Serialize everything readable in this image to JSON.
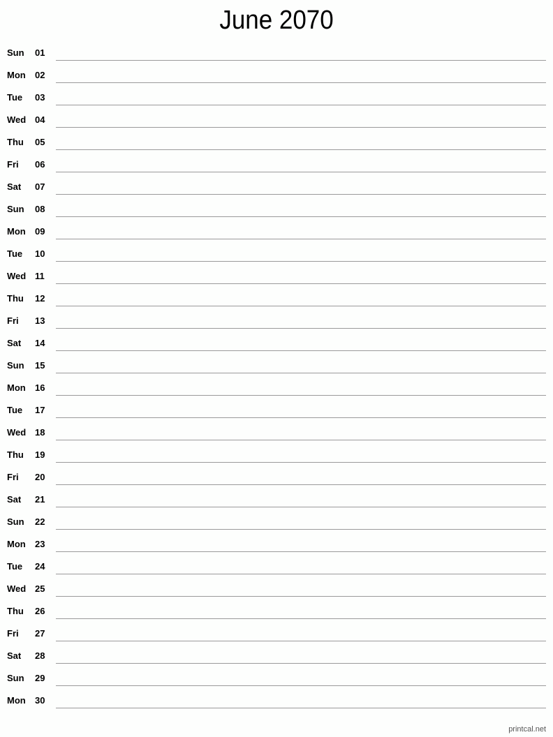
{
  "title": "June 2070",
  "days": [
    {
      "dow": "Sun",
      "day": "01"
    },
    {
      "dow": "Mon",
      "day": "02"
    },
    {
      "dow": "Tue",
      "day": "03"
    },
    {
      "dow": "Wed",
      "day": "04"
    },
    {
      "dow": "Thu",
      "day": "05"
    },
    {
      "dow": "Fri",
      "day": "06"
    },
    {
      "dow": "Sat",
      "day": "07"
    },
    {
      "dow": "Sun",
      "day": "08"
    },
    {
      "dow": "Mon",
      "day": "09"
    },
    {
      "dow": "Tue",
      "day": "10"
    },
    {
      "dow": "Wed",
      "day": "11"
    },
    {
      "dow": "Thu",
      "day": "12"
    },
    {
      "dow": "Fri",
      "day": "13"
    },
    {
      "dow": "Sat",
      "day": "14"
    },
    {
      "dow": "Sun",
      "day": "15"
    },
    {
      "dow": "Mon",
      "day": "16"
    },
    {
      "dow": "Tue",
      "day": "17"
    },
    {
      "dow": "Wed",
      "day": "18"
    },
    {
      "dow": "Thu",
      "day": "19"
    },
    {
      "dow": "Fri",
      "day": "20"
    },
    {
      "dow": "Sat",
      "day": "21"
    },
    {
      "dow": "Sun",
      "day": "22"
    },
    {
      "dow": "Mon",
      "day": "23"
    },
    {
      "dow": "Tue",
      "day": "24"
    },
    {
      "dow": "Wed",
      "day": "25"
    },
    {
      "dow": "Thu",
      "day": "26"
    },
    {
      "dow": "Fri",
      "day": "27"
    },
    {
      "dow": "Sat",
      "day": "28"
    },
    {
      "dow": "Sun",
      "day": "29"
    },
    {
      "dow": "Mon",
      "day": "30"
    }
  ],
  "footer": "printcal.net"
}
